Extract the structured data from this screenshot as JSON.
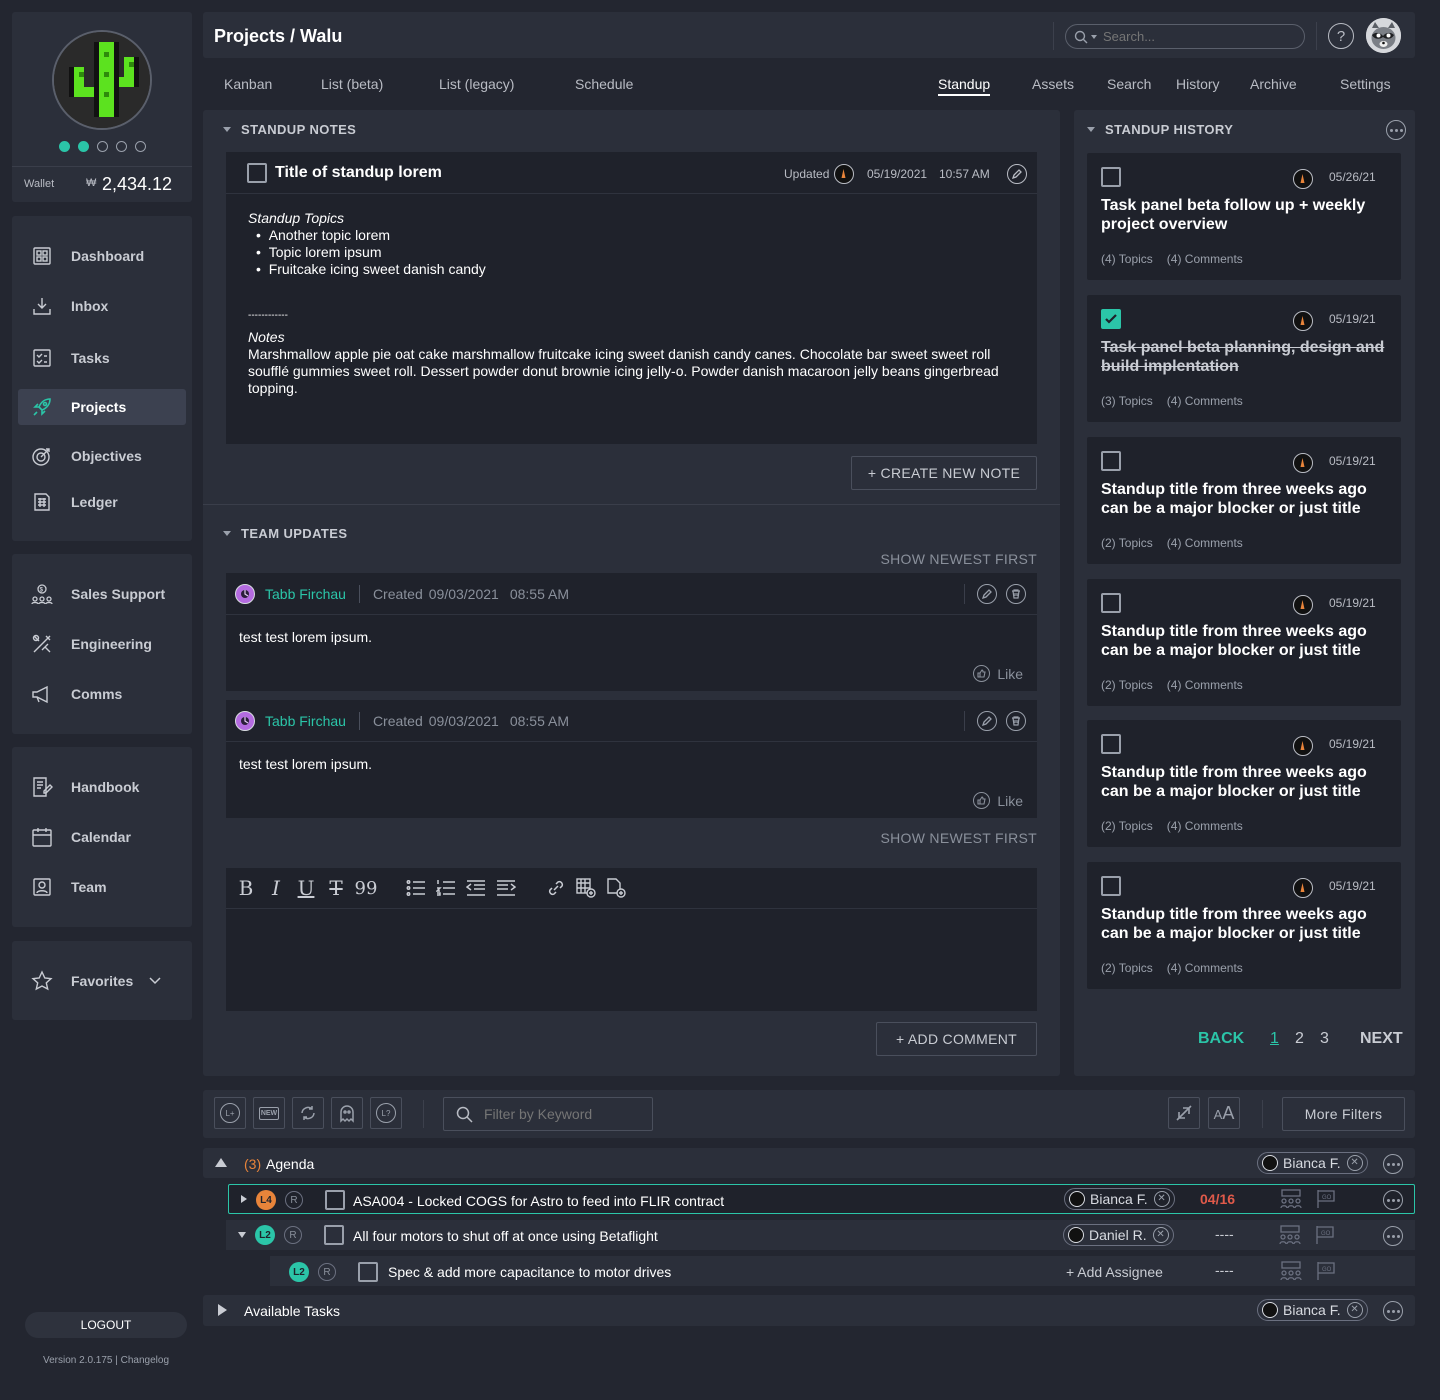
{
  "sidebar": {
    "dots_count": 5,
    "wallet_label": "Wallet",
    "wallet_currency": "₩",
    "wallet_amount": "2,434.12",
    "nav1": [
      {
        "label": "Dashboard",
        "icon": "dashboard-icon"
      },
      {
        "label": "Inbox",
        "icon": "inbox-icon"
      },
      {
        "label": "Tasks",
        "icon": "tasks-icon"
      },
      {
        "label": "Projects",
        "icon": "rocket-icon",
        "active": true
      },
      {
        "label": "Objectives",
        "icon": "target-icon"
      },
      {
        "label": "Ledger",
        "icon": "ledger-icon"
      }
    ],
    "nav2": [
      {
        "label": "Sales Support",
        "icon": "sales-icon"
      },
      {
        "label": "Engineering",
        "icon": "tools-icon"
      },
      {
        "label": "Comms",
        "icon": "megaphone-icon"
      }
    ],
    "nav3": [
      {
        "label": "Handbook",
        "icon": "handbook-icon"
      },
      {
        "label": "Calendar",
        "icon": "calendar-icon"
      },
      {
        "label": "Team",
        "icon": "team-icon"
      }
    ],
    "favorites_label": "Favorites",
    "logout_label": "LOGOUT",
    "version": "Version 2.0.175 | Changelog"
  },
  "header": {
    "breadcrumb": "Projects / Walu",
    "search_placeholder": "Search..."
  },
  "tabs": {
    "left": [
      "Kanban",
      "List (beta)",
      "List (legacy)",
      "Schedule"
    ],
    "right": [
      "Standup",
      "Assets",
      "Search",
      "History",
      "Archive",
      "Settings"
    ],
    "active": "Standup"
  },
  "standup_notes": {
    "section_title": "STANDUP NOTES",
    "note_title": "Title of standup lorem",
    "updated_label": "Updated",
    "updated_date": "05/19/2021",
    "updated_time": "10:57 AM",
    "topics_heading": "Standup Topics",
    "topics": [
      "Another topic lorem",
      "Topic lorem ipsum",
      "Fruitcake icing sweet danish candy"
    ],
    "divider_text": "------------",
    "notes_heading": "Notes",
    "notes_body": "Marshmallow apple pie oat cake marshmallow fruitcake icing sweet danish candy canes. Chocolate bar sweet sweet roll soufflé gummies sweet roll. Dessert powder donut brownie icing jelly-o. Powder danish macaroon jelly beans gingerbread topping.",
    "create_button": "+ CREATE NEW NOTE"
  },
  "team_updates": {
    "section_title": "TEAM UPDATES",
    "sort_label_top": "SHOW NEWEST FIRST",
    "sort_label_bottom": "SHOW NEWEST FIRST",
    "updates": [
      {
        "author": "Tabb Firchau",
        "created_label": "Created",
        "date": "09/03/2021",
        "time": "08:55 AM",
        "body": "test test lorem ipsum.",
        "like_label": "Like"
      },
      {
        "author": "Tabb Firchau",
        "created_label": "Created",
        "date": "09/03/2021",
        "time": "08:55 AM",
        "body": "test test lorem ipsum.",
        "like_label": "Like"
      }
    ],
    "add_comment_button": "+ ADD COMMENT"
  },
  "standup_history": {
    "section_title": "STANDUP HISTORY",
    "cards": [
      {
        "title": "Task panel beta follow up + weekly project overview",
        "date": "05/26/21",
        "topics": "(4) Topics",
        "comments": "(4) Comments",
        "checked": false
      },
      {
        "title": "Task panel beta planning, design and build implentation",
        "date": "05/19/21",
        "topics": "(3) Topics",
        "comments": "(4) Comments",
        "checked": true
      },
      {
        "title": "Standup title from three weeks ago can be a major blocker or just title",
        "date": "05/19/21",
        "topics": "(2) Topics",
        "comments": "(4) Comments",
        "checked": false
      },
      {
        "title": "Standup title from three weeks ago can be a major blocker or just title",
        "date": "05/19/21",
        "topics": "(2) Topics",
        "comments": "(4) Comments",
        "checked": false
      },
      {
        "title": "Standup title from three weeks ago can be a major blocker or just title",
        "date": "05/19/21",
        "topics": "(2) Topics",
        "comments": "(4) Comments",
        "checked": false
      },
      {
        "title": "Standup title from three weeks ago can be a major blocker or just title",
        "date": "05/19/21",
        "topics": "(2) Topics",
        "comments": "(4) Comments",
        "checked": false
      }
    ],
    "pagination": {
      "back": "BACK",
      "pages": [
        "1",
        "2",
        "3"
      ],
      "current": "1",
      "next": "NEXT"
    }
  },
  "task_toolbar": {
    "filter_placeholder": "Filter by Keyword",
    "more_filters": "More Filters"
  },
  "task_groups": {
    "agenda": {
      "count": "(3)",
      "label": "Agenda",
      "assignee": "Bianca F."
    },
    "rows": [
      {
        "level": "L4",
        "level_color": "#e8843a",
        "r": "R",
        "title": "ASA004 - Locked COGS for Astro to feed into FLIR contract",
        "assignee": "Bianca F.",
        "due": "04/16"
      },
      {
        "level": "L2",
        "level_color": "#2bc5a8",
        "r": "R",
        "title": "All four motors to shut off at once using Betaflight",
        "assignee": "Daniel R.",
        "due": "----"
      },
      {
        "level": "L2",
        "level_color": "#2bc5a8",
        "r": "R",
        "title": "Spec & add more capacitance to motor drives",
        "assignee_add": "+ Add Assignee",
        "due": "----"
      }
    ],
    "available": {
      "label": "Available Tasks",
      "assignee": "Bianca F."
    }
  },
  "colors": {
    "accent": "#2bc5a8",
    "due_red": "#e05a4a",
    "level_orange": "#e8843a"
  }
}
